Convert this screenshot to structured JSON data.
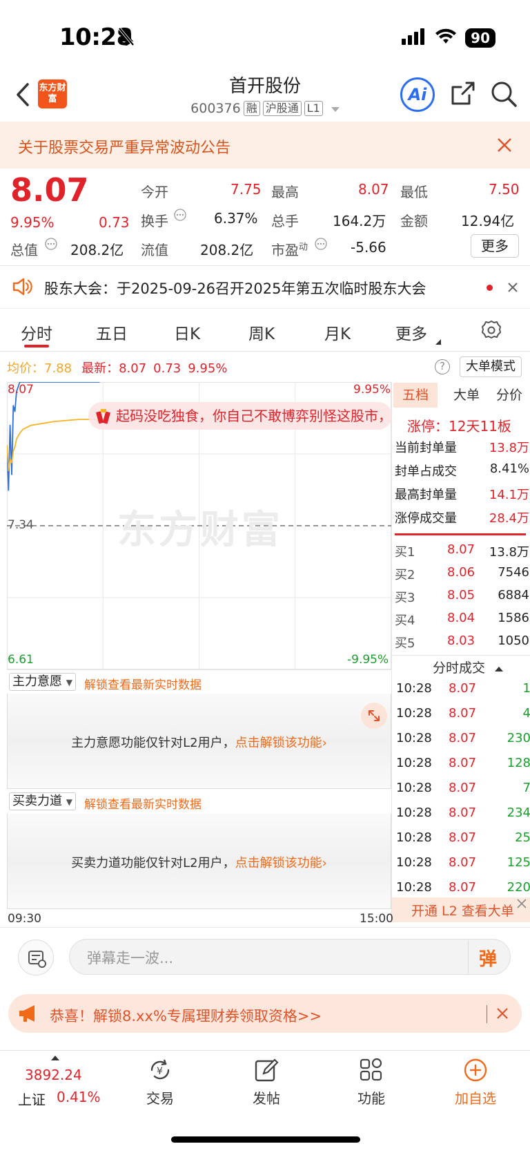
{
  "status": {
    "time": "10:28",
    "battery": "90"
  },
  "header": {
    "logo_text": "东方财富",
    "title": "首开股份",
    "code": "600376",
    "tags": [
      "融",
      "沪股通",
      "L1"
    ],
    "ai_label": "Ai"
  },
  "notice": {
    "text": "关于股票交易严重异常波动公告"
  },
  "quote": {
    "price": "8.07",
    "change_pct": "9.95%",
    "change": "0.73",
    "open_label": "今开",
    "open": "7.75",
    "high_label": "最高",
    "high": "8.07",
    "low_label": "最低",
    "low": "7.50",
    "turnover_label": "换手",
    "turnover": "6.37%",
    "volume_label": "总手",
    "volume": "164.2万",
    "amount_label": "金额",
    "amount": "12.94亿",
    "mktcap_label": "总值",
    "mktcap": "208.2亿",
    "float_label": "流值",
    "float": "208.2亿",
    "pe_label": "市盈",
    "pe_sup": "动",
    "pe": "-5.66",
    "more_button": "更多"
  },
  "meeting": {
    "text": "股东大会：于2025-09-26召开2025年第五次临时股东大会"
  },
  "tabs": [
    "分时",
    "五日",
    "日K",
    "周K",
    "月K",
    "更多"
  ],
  "chart_info": {
    "avg_label": "均价：",
    "avg": "7.88",
    "latest_label": "最新：",
    "latest": "8.07",
    "latest_change": "0.73",
    "latest_pct": "9.95%",
    "mode_button": "大单模式"
  },
  "chart": {
    "y_top": "8.07",
    "y_mid": "7.34",
    "y_bottom": "6.61",
    "pct_top": "9.95%",
    "pct_bottom": "-9.95%",
    "time_start": "09:30",
    "time_end": "15:00",
    "watermark": "东方财富",
    "popup": "起码没吃独食，你自己不敢博弈别怪这股市，"
  },
  "chart_data": {
    "type": "line",
    "x": [
      "09:30",
      "09:31",
      "09:32",
      "09:33",
      "09:34",
      "09:35",
      "09:36",
      "09:38",
      "09:40",
      "09:45",
      "10:00",
      "10:15",
      "10:28"
    ],
    "series": [
      {
        "values": [
          7.75,
          7.52,
          7.85,
          7.6,
          7.95,
          7.92,
          8.02,
          8.07,
          8.07,
          8.07,
          8.07,
          8.07,
          8.07
        ]
      },
      {
        "values": [
          7.75,
          7.62,
          7.68,
          7.66,
          7.72,
          7.74,
          7.78,
          7.81,
          7.83,
          7.85,
          7.87,
          7.88,
          7.88
        ]
      }
    ],
    "ylim": [
      6.61,
      8.07
    ],
    "xlim": [
      "09:30",
      "15:00"
    ],
    "grid": true
  },
  "right_panel": {
    "tabs": [
      "五档",
      "大单",
      "分价"
    ],
    "limit_label": "涨停：",
    "limit_value": "12天11板",
    "stats": [
      {
        "label": "当前封单量",
        "value": "13.8万"
      },
      {
        "label": "封单占成交",
        "value": "8.41%"
      },
      {
        "label": "最高封单量",
        "value": "14.1万"
      },
      {
        "label": "涨停成交量",
        "value": "28.4万"
      }
    ],
    "bids": [
      {
        "label": "买1",
        "price": "8.07",
        "vol": "13.8万"
      },
      {
        "label": "买2",
        "price": "8.06",
        "vol": "7546"
      },
      {
        "label": "买3",
        "price": "8.05",
        "vol": "6884"
      },
      {
        "label": "买4",
        "price": "8.04",
        "vol": "1586"
      },
      {
        "label": "买5",
        "price": "8.03",
        "vol": "1050"
      }
    ],
    "ticks_title": "分时成交",
    "ticks": [
      {
        "t": "10:28",
        "p": "8.07",
        "v": "1"
      },
      {
        "t": "10:28",
        "p": "8.07",
        "v": "4"
      },
      {
        "t": "10:28",
        "p": "8.07",
        "v": "230"
      },
      {
        "t": "10:28",
        "p": "8.07",
        "v": "128"
      },
      {
        "t": "10:28",
        "p": "8.07",
        "v": "7"
      },
      {
        "t": "10:28",
        "p": "8.07",
        "v": "234"
      },
      {
        "t": "10:28",
        "p": "8.07",
        "v": "25"
      },
      {
        "t": "10:28",
        "p": "8.07",
        "v": "125"
      },
      {
        "t": "10:28",
        "p": "8.07",
        "v": "220"
      }
    ],
    "l2_cta": "开通 L2 查看大单"
  },
  "sections": {
    "zhuli": {
      "title": "主力意愿",
      "unlock": "解锁查看最新实时数据",
      "text": "主力意愿功能仅针对L2用户，",
      "link": "点击解锁该功能"
    },
    "maimai": {
      "title": "买卖力道",
      "unlock": "解锁查看最新实时数据",
      "text": "买卖力道功能仅针对L2用户，",
      "link": "点击解锁该功能"
    }
  },
  "danmu": {
    "placeholder": "弹幕走一波...",
    "button": "弹"
  },
  "promo": {
    "text": "恭喜！解锁8.xx%专属理财券领取资格>>"
  },
  "bottom_nav": {
    "index_value": "3892.24",
    "index_name": "上证",
    "index_pct": "0.41%",
    "items": [
      "交易",
      "发帖",
      "功能",
      "加自选"
    ]
  },
  "colors": {
    "up": "#e0232a",
    "down": "#1a9e2c",
    "accent": "#f06a1a",
    "avg_line": "#f5b324",
    "price_line": "#2e6ed8"
  }
}
